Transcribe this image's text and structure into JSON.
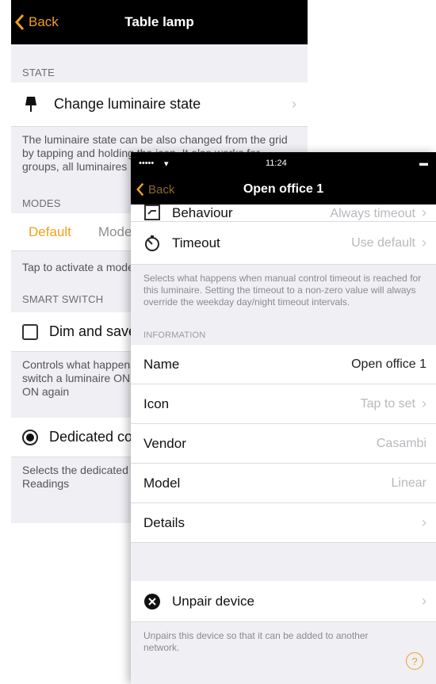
{
  "screen_a": {
    "back_label": "Back",
    "title": "Table lamp",
    "state_header": "STATE",
    "change_state_label": "Change luminaire state",
    "state_footnote": "The luminaire state can be also changed from the grid by tapping and holding the icon. It also works for groups, all luminaires",
    "modes_header": "MODES",
    "modes_tabs": [
      "Default",
      "Modes"
    ],
    "modes_footnote": "Tap to activate a mode",
    "smart_switch_header": "SMART SWITCH",
    "dim_label": "Dim and save",
    "smart_footnote": "Controls what happens when the wall switch is used to switch a luminaire ON and it is quickly flicked OFF and ON again",
    "dedicated_label": "Dedicated control",
    "dedicated_footnote": "Selects the dedicated sensor for this luminaire. Readings"
  },
  "screen_b": {
    "status_left": "•••••",
    "status_time": "11:24",
    "back_label": "Back",
    "title": "Open office 1",
    "behaviour_label": "Behaviour",
    "behaviour_value": "Always timeout",
    "timeout_label": "Timeout",
    "timeout_value": "Use default",
    "timeout_footnote": "Selects what happens when manual control timeout is reached for this luminaire. Setting the timeout to a non-zero value will always override the weekday day/night timeout intervals.",
    "information_header": "INFORMATION",
    "info_rows": [
      {
        "label": "Name",
        "value": "Open office 1"
      },
      {
        "label": "Icon",
        "value": "Tap to set"
      },
      {
        "label": "Vendor",
        "value": "Casambi"
      },
      {
        "label": "Model",
        "value": "Linear"
      },
      {
        "label": "Details",
        "value": ""
      }
    ],
    "unpair_label": "Unpair device",
    "unpair_footnote": "Unpairs this device so that it can be added to another network."
  },
  "colors": {
    "accent": "#f0a01a",
    "navbar": "#000000",
    "group_background": "#efeff4"
  }
}
